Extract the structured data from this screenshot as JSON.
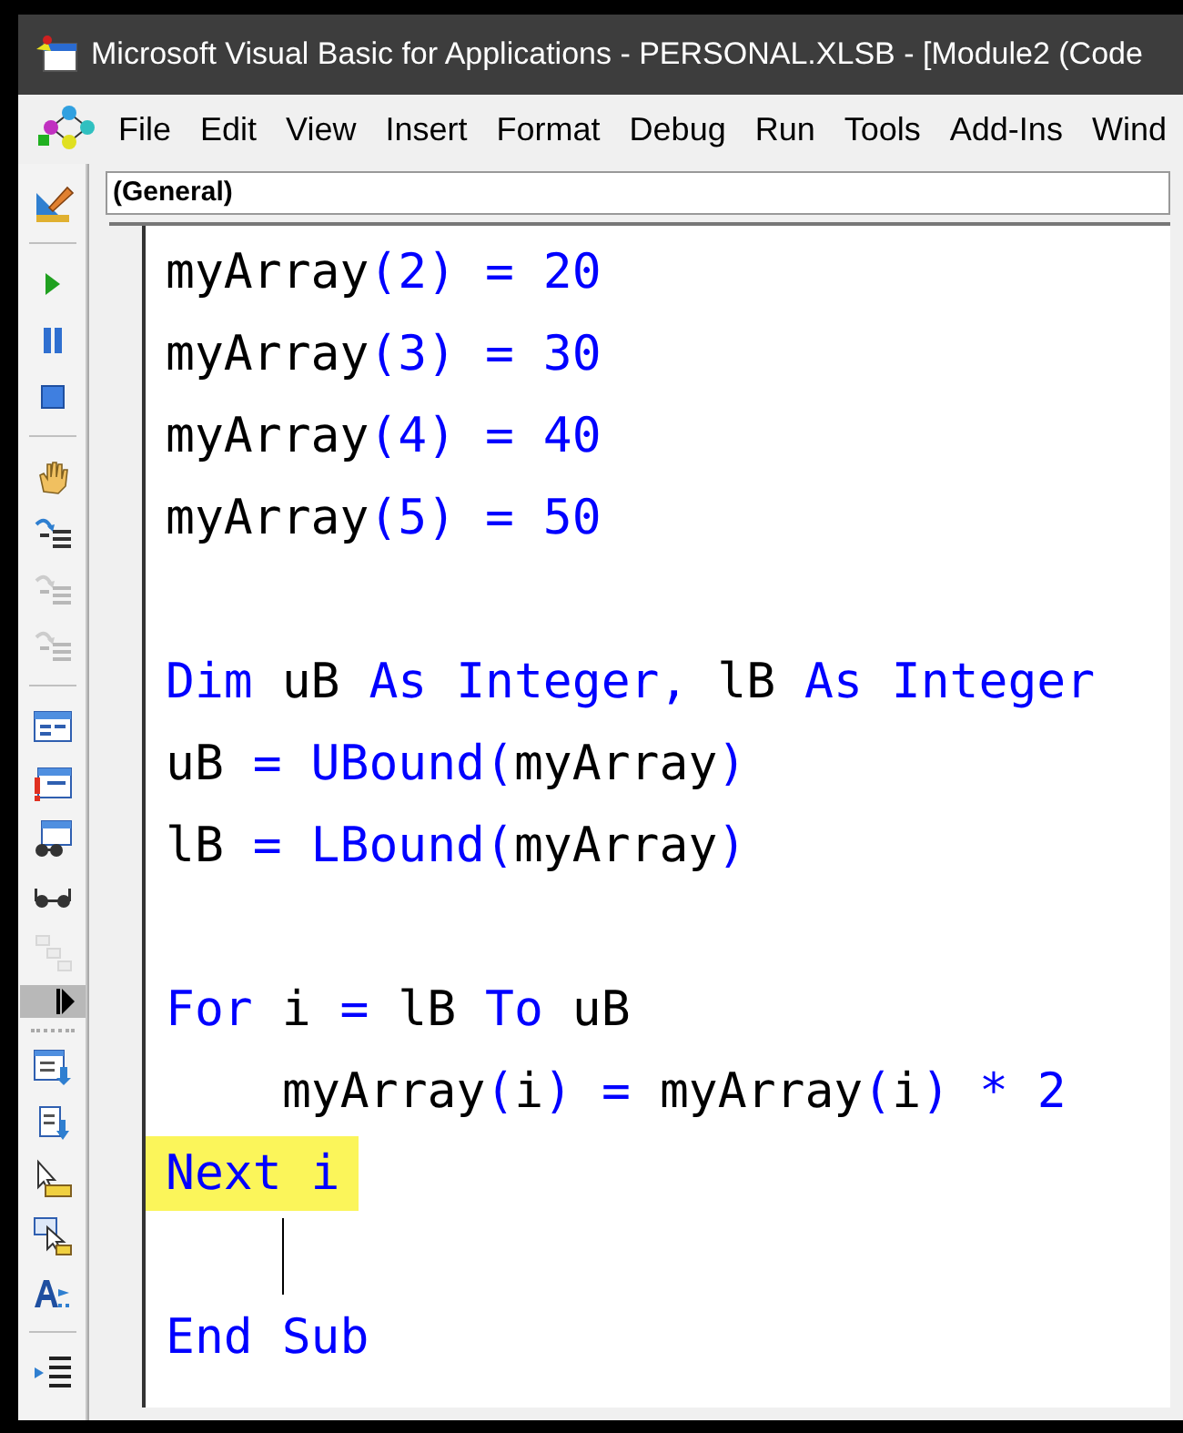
{
  "window": {
    "title": "Microsoft Visual Basic for Applications - PERSONAL.XLSB - [Module2 (Code"
  },
  "menu": [
    {
      "label": "File"
    },
    {
      "label": "Edit"
    },
    {
      "label": "View"
    },
    {
      "label": "Insert"
    },
    {
      "label": "Format"
    },
    {
      "label": "Debug"
    },
    {
      "label": "Run"
    },
    {
      "label": "Tools"
    },
    {
      "label": "Add-Ins"
    },
    {
      "label": "Wind"
    }
  ],
  "toolbar": [
    {
      "kind": "design",
      "disabled": false
    },
    {
      "kind": "separator"
    },
    {
      "kind": "run",
      "disabled": false
    },
    {
      "kind": "pause",
      "disabled": false
    },
    {
      "kind": "stop",
      "disabled": false
    },
    {
      "kind": "separator"
    },
    {
      "kind": "hand",
      "disabled": false
    },
    {
      "kind": "step",
      "disabled": false
    },
    {
      "kind": "step",
      "disabled": true
    },
    {
      "kind": "step",
      "disabled": true
    },
    {
      "kind": "separator"
    },
    {
      "kind": "window",
      "disabled": false
    },
    {
      "kind": "window-alert",
      "disabled": false
    },
    {
      "kind": "glasses-window",
      "disabled": false
    },
    {
      "kind": "glasses",
      "disabled": false
    },
    {
      "kind": "stack",
      "disabled": true
    },
    {
      "kind": "overflow"
    },
    {
      "kind": "list-down",
      "disabled": false
    },
    {
      "kind": "doc-down",
      "disabled": false
    },
    {
      "kind": "pointer",
      "disabled": false
    },
    {
      "kind": "pointer-copy",
      "disabled": false
    },
    {
      "kind": "font",
      "disabled": false
    },
    {
      "kind": "separator"
    },
    {
      "kind": "indent",
      "disabled": false
    }
  ],
  "object_box": {
    "value": "(General)"
  },
  "code_lines": [
    {
      "tokens": [
        {
          "text": "myArray",
          "kind": "plain"
        },
        {
          "text": "(2) = 20",
          "kind": "keyword"
        }
      ]
    },
    {
      "tokens": [
        {
          "text": "myArray",
          "kind": "plain"
        },
        {
          "text": "(3) = 30",
          "kind": "keyword"
        }
      ]
    },
    {
      "tokens": [
        {
          "text": "myArray",
          "kind": "plain"
        },
        {
          "text": "(4) = 40",
          "kind": "keyword"
        }
      ]
    },
    {
      "tokens": [
        {
          "text": "myArray",
          "kind": "plain"
        },
        {
          "text": "(5) = 50",
          "kind": "keyword"
        }
      ]
    },
    {
      "space_before": true,
      "tokens": [
        {
          "text": "Dim",
          "kind": "keyword"
        },
        {
          "text": " uB ",
          "kind": "plain"
        },
        {
          "text": "As Integer,",
          "kind": "keyword"
        },
        {
          "text": " lB ",
          "kind": "plain"
        },
        {
          "text": "As Integer",
          "kind": "keyword"
        }
      ]
    },
    {
      "tokens": [
        {
          "text": "uB",
          "kind": "plain"
        },
        {
          "text": " = UBound(",
          "kind": "keyword"
        },
        {
          "text": "myArray",
          "kind": "plain"
        },
        {
          "text": ")",
          "kind": "keyword"
        }
      ]
    },
    {
      "tokens": [
        {
          "text": "lB",
          "kind": "plain"
        },
        {
          "text": " = LBound(",
          "kind": "keyword"
        },
        {
          "text": "myArray",
          "kind": "plain"
        },
        {
          "text": ")",
          "kind": "keyword"
        }
      ]
    },
    {
      "space_before": true,
      "tokens": [
        {
          "text": "For",
          "kind": "keyword"
        },
        {
          "text": " i ",
          "kind": "plain"
        },
        {
          "text": "=",
          "kind": "keyword"
        },
        {
          "text": " lB ",
          "kind": "plain"
        },
        {
          "text": "To",
          "kind": "keyword"
        },
        {
          "text": " uB",
          "kind": "plain"
        }
      ]
    },
    {
      "indented": true,
      "tokens": [
        {
          "text": "myArray",
          "kind": "plain"
        },
        {
          "text": "(",
          "kind": "keyword"
        },
        {
          "text": "i",
          "kind": "plain"
        },
        {
          "text": ") = ",
          "kind": "keyword"
        },
        {
          "text": "myArray",
          "kind": "plain"
        },
        {
          "text": "(",
          "kind": "keyword"
        },
        {
          "text": "i",
          "kind": "plain"
        },
        {
          "text": ") * 2",
          "kind": "keyword"
        }
      ]
    },
    {
      "highlighted": true,
      "tokens": [
        {
          "text": "Next i",
          "kind": "keyword"
        }
      ]
    },
    {
      "cursor": true
    },
    {
      "tokens": [
        {
          "text": "End Sub",
          "kind": "keyword"
        }
      ]
    }
  ]
}
